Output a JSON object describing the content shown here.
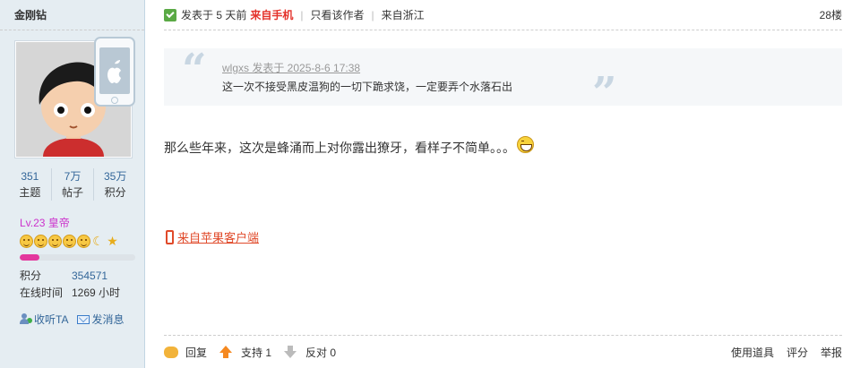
{
  "user": {
    "name": "金刚钻",
    "stats": [
      {
        "value": "351",
        "label": "主题"
      },
      {
        "value": "7万",
        "label": "帖子"
      },
      {
        "value": "35万",
        "label": "积分"
      }
    ],
    "rank": "Lv.23 皇帝",
    "level_progress": 0.17,
    "info": [
      {
        "key": "积分",
        "value": "354571"
      },
      {
        "key": "在线时间",
        "value": "1269 小时"
      }
    ],
    "actions": {
      "follow": "收听TA",
      "message": "发消息"
    }
  },
  "post": {
    "posted": "发表于 5 天前",
    "from_mobile": "来自手机",
    "only_author": "只看该作者",
    "location": "来自浙江",
    "floor": "28楼",
    "quote": {
      "author_line": "wlgxs 发表于 2025-8-6 17:38",
      "text": "这一次不接受黑皮温狗的一切下跪求饶，一定要弄个水落石出"
    },
    "content": "那么些年来，这次是蜂涌而上对你露出獠牙，看样子不简单。。。",
    "client_link": "来自苹果客户端"
  },
  "footer": {
    "reply": "回复",
    "support": "支持 1",
    "oppose": "反对 0",
    "tools": "使用道具",
    "rate": "评分",
    "report": "举报"
  },
  "colors": {
    "sidebar_bg": "#e5edf2",
    "link": "#336699",
    "rank": "#cc33cc",
    "accent_red": "#e04a2a",
    "progress": "#e3379d"
  }
}
